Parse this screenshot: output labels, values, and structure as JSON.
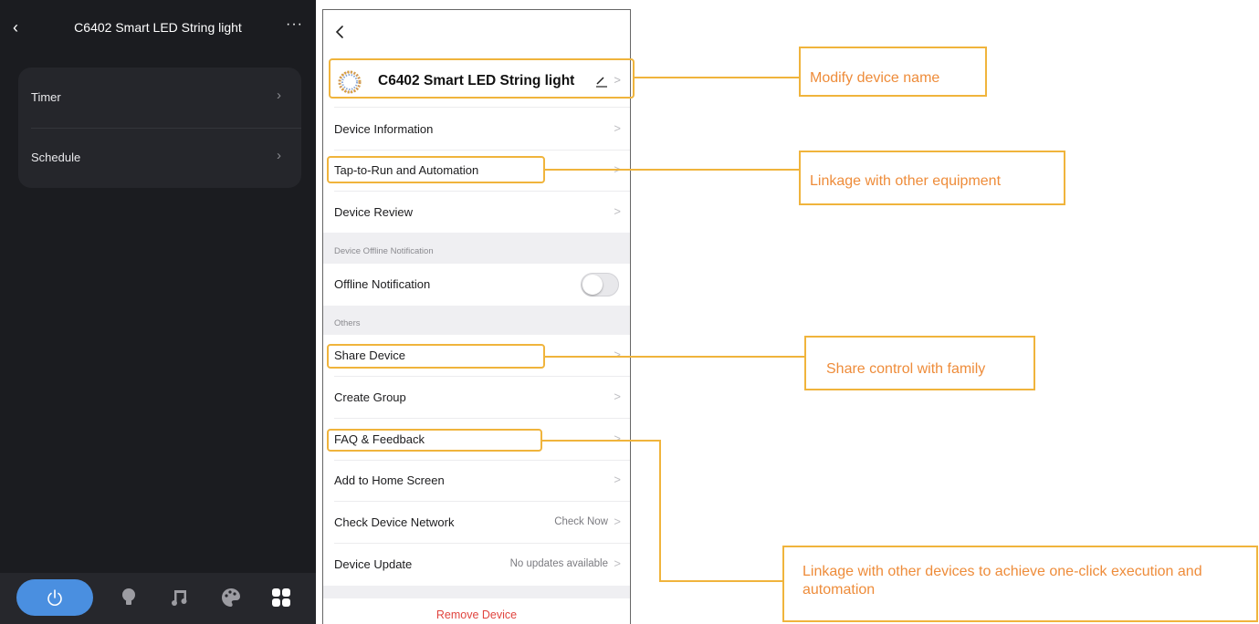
{
  "left_screen": {
    "title": "C6402 Smart LED String light",
    "back_glyph": "‹",
    "more_glyph": "···",
    "items": [
      {
        "label": "Timer",
        "chevron": "›"
      },
      {
        "label": "Schedule",
        "chevron": "›"
      }
    ],
    "bottom_tabs": [
      {
        "icon": "power-icon",
        "active": true
      },
      {
        "icon": "bulb-icon",
        "active": false
      },
      {
        "icon": "music-icon",
        "active": false
      },
      {
        "icon": "palette-icon",
        "active": false
      },
      {
        "icon": "grid-icon",
        "active": false
      }
    ],
    "colors": {
      "background": "#1b1c20",
      "card": "#25262b",
      "accent": "#4a8fe0"
    }
  },
  "right_screen": {
    "device_name": "C6402 Smart LED String light",
    "rows": {
      "device_information": "Device Information",
      "tap_to_run": "Tap-to-Run and Automation",
      "device_review": "Device Review",
      "offline_section": "Device Offline Notification",
      "offline_notification": "Offline Notification",
      "others_section": "Others",
      "share_device": "Share Device",
      "create_group": "Create Group",
      "faq": "FAQ & Feedback",
      "add_home": "Add to Home Screen",
      "check_network": "Check Device Network",
      "check_network_value": "Check Now",
      "device_update": "Device Update",
      "device_update_value": "No updates available",
      "remove": "Remove Device"
    },
    "offline_toggle_on": false,
    "colors": {
      "remove": "#e0443e",
      "section_bg": "#efeff2"
    }
  },
  "annotations": {
    "modify_name": "Modify device name",
    "linkage": "Linkage with other equipment",
    "share_control": "Share control with family",
    "one_click": "Linkage with other devices to achieve one-click execution and automation",
    "color": "#f0b43c",
    "text_color": "#ee8c3a"
  }
}
